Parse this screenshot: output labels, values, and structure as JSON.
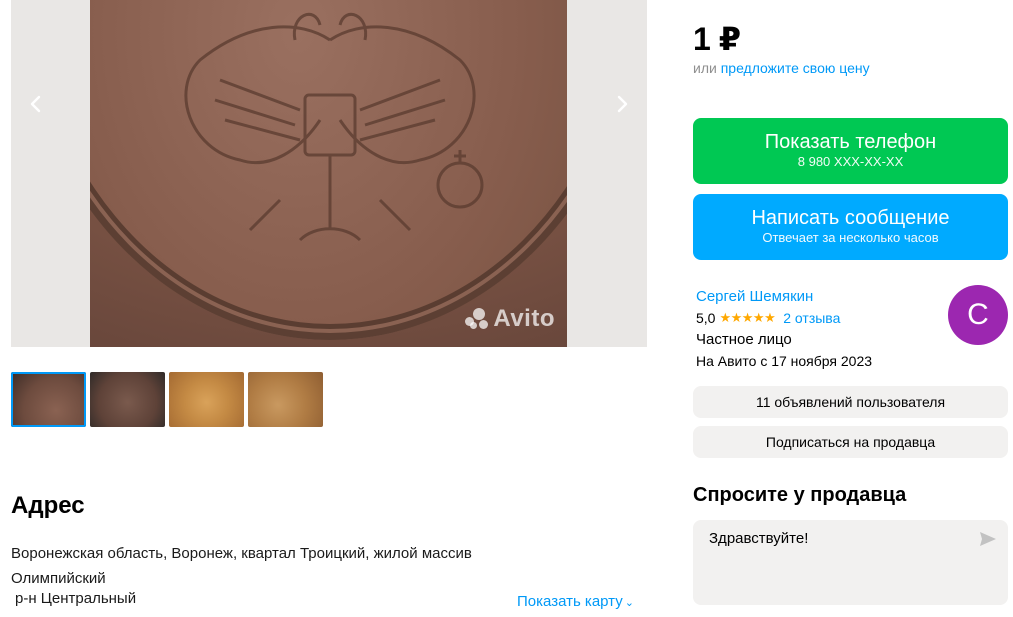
{
  "gallery": {
    "prev_icon": "chevron-left-icon",
    "next_icon": "chevron-right-icon",
    "watermark": "Avito",
    "thumb_count": 4
  },
  "price": {
    "value": "1 ₽"
  },
  "offer": {
    "prefix": "или",
    "link": "предложите свою цену"
  },
  "phone_button": {
    "label": "Показать телефон",
    "number": "8 980 XXX-XX-XX",
    "color": "#00c853"
  },
  "message_button": {
    "label": "Написать сообщение",
    "sub": "Отвечает за несколько часов",
    "color": "#00aaff"
  },
  "seller": {
    "name": "Сергей Шемякин",
    "rating": "5,0",
    "stars": "★★★★★",
    "reviews": "2 отзыва",
    "type": "Частное лицо",
    "since": "На Авито с 17 ноября 2023",
    "avatar_letter": "С",
    "avatar_color": "#9c27b0"
  },
  "buttons": {
    "listings": "11 объявлений пользователя",
    "subscribe": "Подписаться на продавца"
  },
  "ask": {
    "title": "Спросите у продавца",
    "message": "Здравствуйте!",
    "send_icon": "send-icon"
  },
  "address": {
    "title": "Адрес",
    "text": "Воронежская область, Воронеж, квартал Троицкий, жилой массив Олимпийский",
    "district": "р-н Центральный",
    "show_map": "Показать карту"
  },
  "colors": {
    "link": "#0099f7",
    "star": "#ffa800"
  }
}
